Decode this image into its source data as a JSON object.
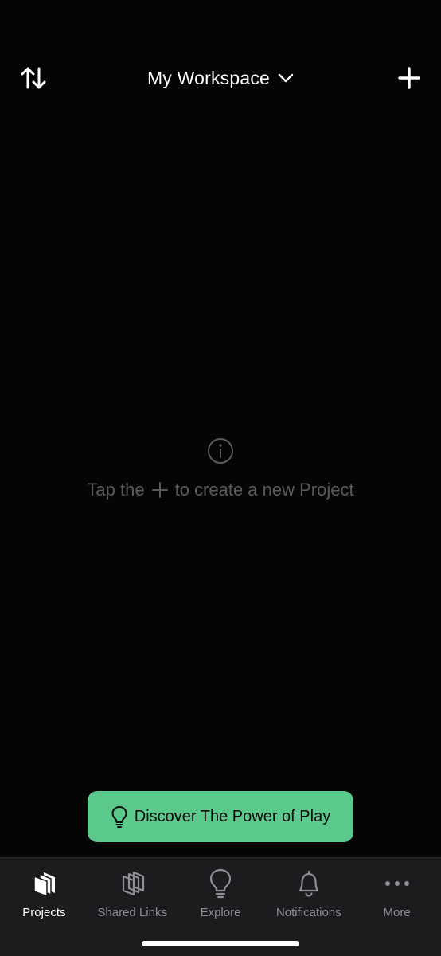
{
  "header": {
    "workspace_title": "My Workspace",
    "icons": {
      "sort": "sort-arrows-icon",
      "dropdown": "chevron-down-icon",
      "add": "plus-icon"
    }
  },
  "empty_state": {
    "icon": "info-icon",
    "text_before": "Tap the",
    "text_after": "to create a new Project"
  },
  "discover_button": {
    "label": "Discover The Power of Play",
    "icon": "lightbulb-icon",
    "background_color": "#5cc98c"
  },
  "tab_bar": {
    "tabs": [
      {
        "label": "Projects",
        "icon": "projects-stack-icon",
        "active": true
      },
      {
        "label": "Shared Links",
        "icon": "shared-links-stack-icon",
        "active": false
      },
      {
        "label": "Explore",
        "icon": "lightbulb-icon",
        "active": false
      },
      {
        "label": "Notifications",
        "icon": "bell-icon",
        "active": false
      },
      {
        "label": "More",
        "icon": "more-dots-icon",
        "active": false
      }
    ]
  },
  "colors": {
    "background": "#050505",
    "tab_bar": "#1c1c1e",
    "muted_text": "#5a5a5e",
    "inactive_tab": "#8e8e93",
    "accent": "#5cc98c"
  }
}
